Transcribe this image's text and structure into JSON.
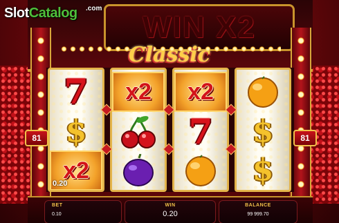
{
  "logo": {
    "part1": "Slot",
    "part2": "Catalog",
    "domain": ".com"
  },
  "sign": {
    "title": "WIN X2",
    "subtitle": "Classic"
  },
  "lines": {
    "left": "81",
    "right": "81"
  },
  "reels": [
    [
      {
        "symbol": "seven",
        "text": "7"
      },
      {
        "symbol": "dollar",
        "text": "$"
      },
      {
        "symbol": "x2",
        "text": "x2",
        "highlight": true,
        "win_amount": "0.20"
      }
    ],
    [
      {
        "symbol": "x2",
        "text": "x2",
        "highlight": true
      },
      {
        "symbol": "cherries",
        "text": ""
      },
      {
        "symbol": "plum",
        "text": ""
      }
    ],
    [
      {
        "symbol": "x2",
        "text": "x2",
        "highlight": true
      },
      {
        "symbol": "seven",
        "text": "7"
      },
      {
        "symbol": "orange",
        "text": ""
      }
    ],
    [
      {
        "symbol": "orange",
        "text": ""
      },
      {
        "symbol": "dollar",
        "text": "$"
      },
      {
        "symbol": "dollar",
        "text": "$"
      }
    ]
  ],
  "bottom_bar": {
    "bet_label": "BET",
    "bet_value": "0.10",
    "win_label": "WIN",
    "win_value": "0.20",
    "balance_label": "BALANCE",
    "balance_value": "99 999.70"
  },
  "colors": {
    "frame_gold": "#d9a63a",
    "sign_red": "#d8131b",
    "reel_bg": "#fffdf4"
  }
}
